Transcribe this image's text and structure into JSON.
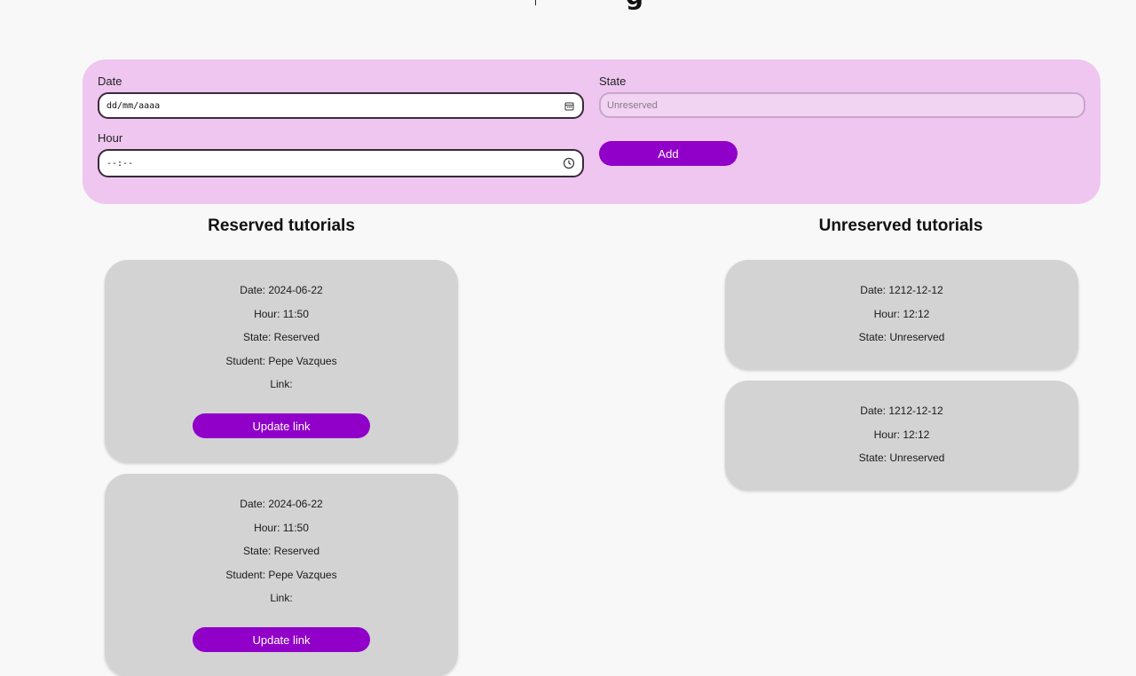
{
  "form": {
    "date_label": "Date",
    "date_value": "dd/mm/aaaa",
    "hour_label": "Hour",
    "hour_value": "--:--",
    "state_label": "State",
    "state_placeholder": "Unreserved",
    "add_label": "Add"
  },
  "reserved": {
    "title": "Reserved tutorials",
    "cards": [
      {
        "date": "Date: 2024-06-22",
        "hour": "Hour: 11:50",
        "state": "State: Reserved",
        "student": "Student: Pepe Vazques",
        "link": "Link:",
        "button": "Update link"
      },
      {
        "date": "Date: 2024-06-22",
        "hour": "Hour: 11:50",
        "state": "State: Reserved",
        "student": "Student: Pepe Vazques",
        "link": "Link:",
        "button": "Update link"
      }
    ]
  },
  "unreserved": {
    "title": "Unreserved tutorials",
    "cards": [
      {
        "date": "Date: 1212-12-12",
        "hour": "Hour: 12:12",
        "state": "State: Unreserved"
      },
      {
        "date": "Date: 1212-12-12",
        "hour": "Hour: 12:12",
        "state": "State: Unreserved"
      }
    ]
  },
  "colors": {
    "panel": "#efc6f0",
    "accent": "#9000c8",
    "card": "#d3d3d3"
  },
  "icons": {
    "date_icon": "calendar-icon",
    "hour_icon": "clock-icon"
  }
}
